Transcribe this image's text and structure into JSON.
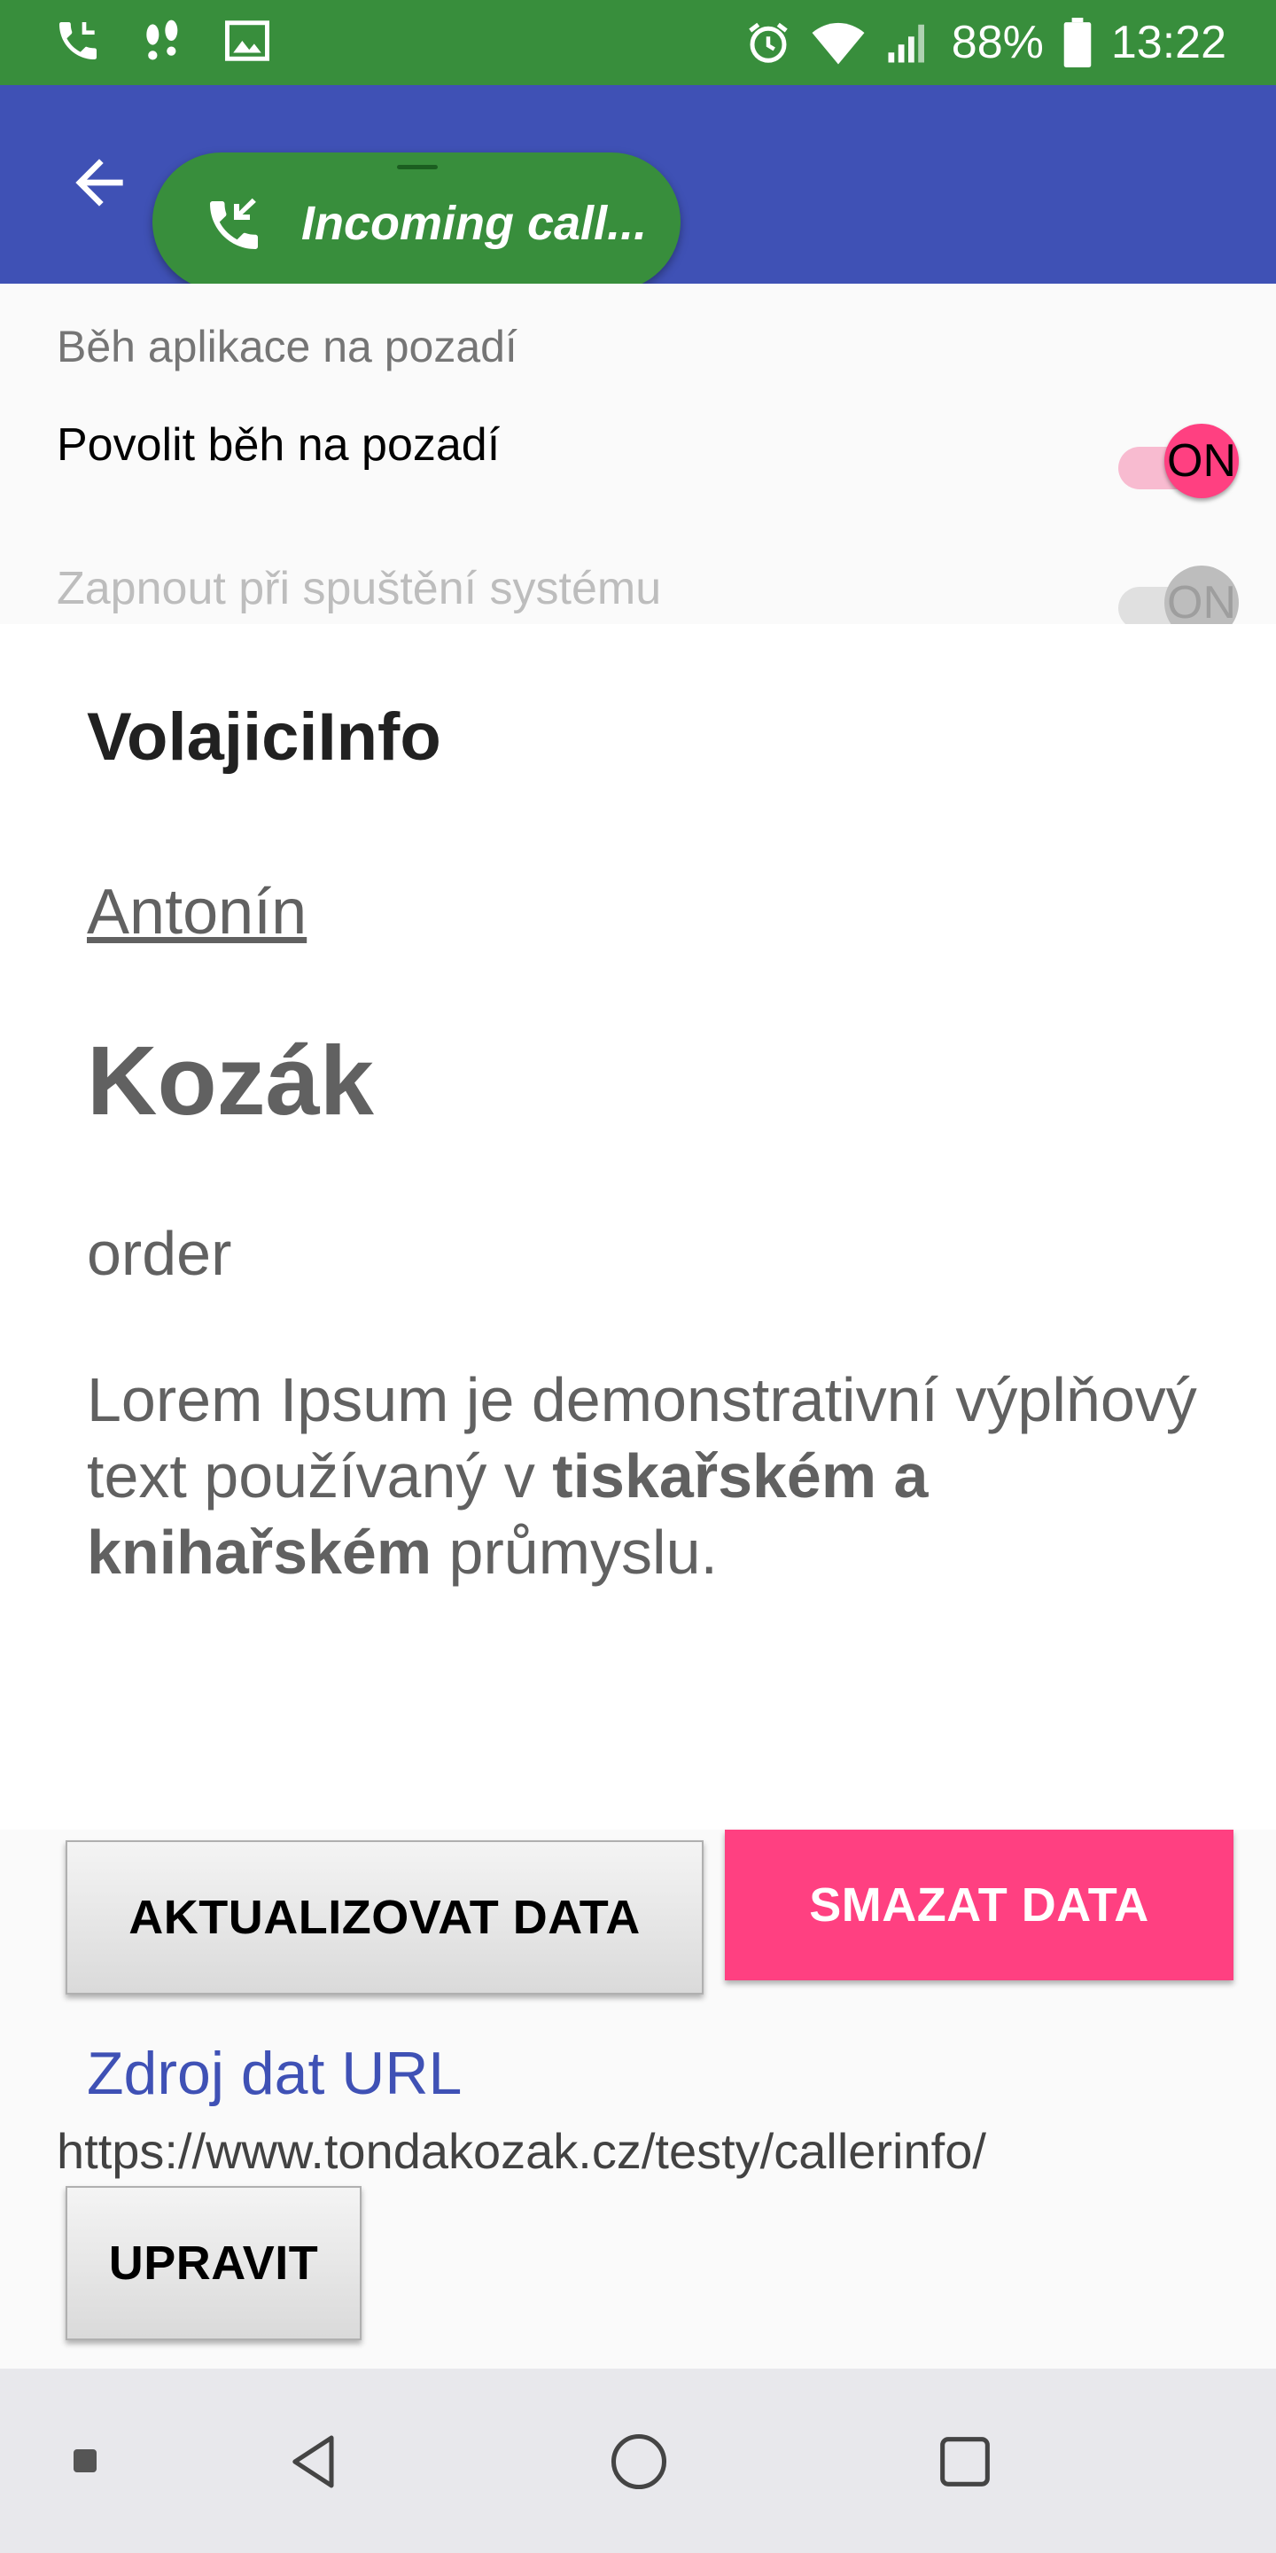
{
  "status_bar": {
    "battery": "88%",
    "time": "13:22",
    "left_icons": [
      "phone-icon",
      "voicemail-icon",
      "image-icon"
    ],
    "right_icons": [
      "alarm-icon",
      "wifi-icon",
      "signal-icon",
      "battery-icon"
    ]
  },
  "app_bar": {
    "color": "#3f51b5",
    "back_icon": "back-arrow-icon"
  },
  "call_bubble": {
    "label": "Incoming call...",
    "icon": "incoming-call-icon",
    "color": "#388e3c"
  },
  "settings": {
    "section_header": "Běh aplikace na pozadí",
    "items": [
      {
        "title": "Povolit běh na pozadí",
        "switch_label": "ON",
        "enabled": true,
        "checked": true
      },
      {
        "title": "Zapnout při spuštění systému",
        "switch_label": "ON",
        "enabled": false,
        "checked": false
      }
    ]
  },
  "caller_card": {
    "title": "VolajiciInfo",
    "first_name": "Antonín",
    "last_name": "Kozák",
    "order": "order",
    "description": {
      "part1": "Lorem Ipsum je demonstrativní výplňový text používaný v ",
      "bold": "tiskařském a knihařském",
      "part2": " průmyslu."
    }
  },
  "actions": {
    "update_label": "AKTUALIZOVAT DATA",
    "delete_label": "SMAZAT DATA",
    "source_label": "Zdroj dat URL",
    "source_url": "https://www.tondakozak.cz/testy/callerinfo/",
    "edit_label": "UPRAVIT"
  },
  "accent_color": "#ff4081",
  "nav_bar": {
    "icons": [
      "dot-icon",
      "back-icon",
      "home-icon",
      "recents-icon"
    ]
  }
}
